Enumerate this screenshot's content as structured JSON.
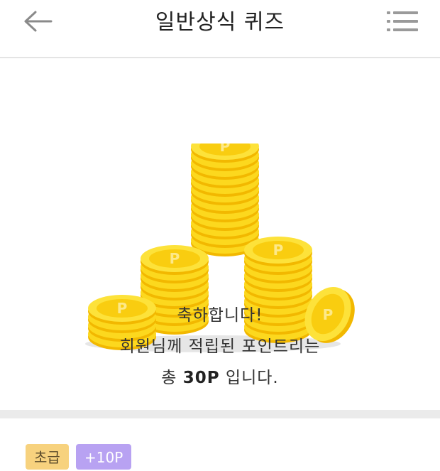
{
  "header": {
    "title": "일반상식 퀴즈",
    "back_icon": "arrow-left-icon",
    "menu_icon": "list-menu-icon"
  },
  "result": {
    "illustration": "coin-stacks-illustration",
    "line1": "축하합니다!",
    "line2": "회원님께 적립된 포인트리는",
    "line3_prefix": "총 ",
    "line3_points": "30P",
    "line3_suffix": " 입니다."
  },
  "tags": {
    "level": "초급",
    "points": "+10P"
  },
  "colors": {
    "coin": "#f8d21e",
    "level_tag": "#f7d27e",
    "point_tag": "#b8a2f2"
  }
}
